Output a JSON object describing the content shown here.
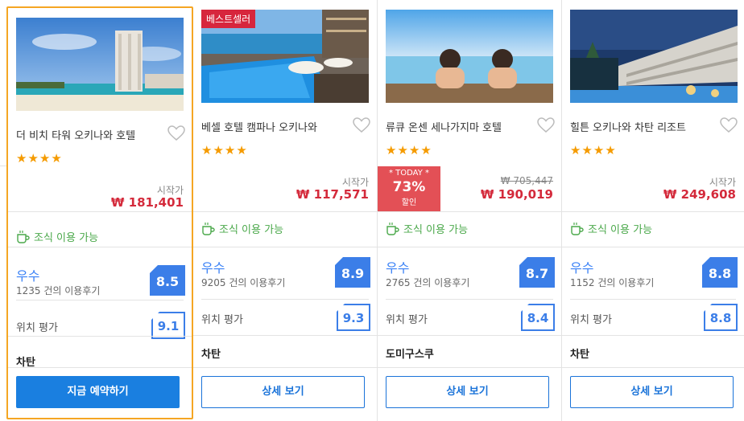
{
  "hotels": [
    {
      "name": "더 비치 타워 오키나와 호텔",
      "badge": "",
      "stars": "★★★★",
      "from_label": "시작가",
      "price": "₩ 181,401",
      "original_price": "",
      "breakfast": "조식 이용 가능",
      "grade": "우수",
      "reviews": "1235 건의 이용후기",
      "score": "8.5",
      "location_label": "위치 평가",
      "location_score": "9.1",
      "area": "차탄",
      "button": "지금 예약하기",
      "selected": true
    },
    {
      "name": "베셀 호텔 캠파나 오키나와",
      "badge": "베스트셀러",
      "stars": "★★★★",
      "from_label": "시작가",
      "price": "₩ 117,571",
      "original_price": "",
      "breakfast": "조식 이용 가능",
      "grade": "우수",
      "reviews": "9205 건의 이용후기",
      "score": "8.9",
      "location_label": "위치 평가",
      "location_score": "9.3",
      "area": "차탄",
      "button": "상세 보기",
      "selected": false
    },
    {
      "name": "류큐 온센 세나가지마 호텔",
      "badge": "",
      "stars": "★★★★",
      "from_label": "",
      "price": "₩ 190,019",
      "original_price": "₩ 705,447",
      "deal": {
        "tag": "* TODAY *",
        "percent": "73%",
        "label": "할인"
      },
      "breakfast": "조식 이용 가능",
      "grade": "우수",
      "reviews": "2765 건의 이용후기",
      "score": "8.7",
      "location_label": "위치 평가",
      "location_score": "8.4",
      "area": "도미구스쿠",
      "button": "상세 보기",
      "selected": false
    },
    {
      "name": "힐튼 오키나와 차탄 리조트",
      "badge": "",
      "stars": "★★★★",
      "from_label": "시작가",
      "price": "₩ 249,608",
      "original_price": "",
      "breakfast": "조식 이용 가능",
      "grade": "우수",
      "reviews": "1152 건의 이용후기",
      "score": "8.8",
      "location_label": "위치 평가",
      "location_score": "8.8",
      "area": "차탄",
      "button": "상세 보기",
      "selected": false
    }
  ],
  "colors": {
    "accent": "#1a7fe0",
    "price": "#d42a3b",
    "star": "#f59b00",
    "breakfast": "#4aa84a",
    "score": "#3b7ee8",
    "selected_border": "#f5a623",
    "deal": "#e35056"
  }
}
